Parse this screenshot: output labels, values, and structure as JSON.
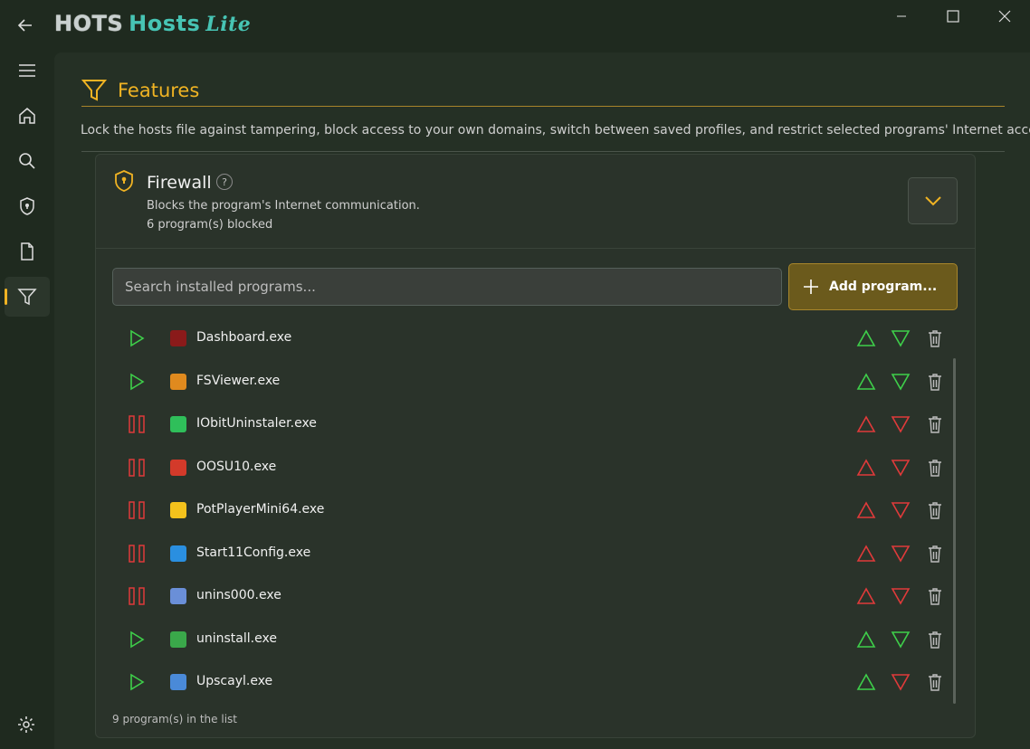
{
  "app": {
    "logo_hots": "HOTS",
    "logo_hosts": "Hosts",
    "logo_lite": "Lite"
  },
  "colors": {
    "accent": "#f0b323",
    "allow": "#3ecf4a",
    "block": "#e03a3a",
    "teal": "#47c4b4"
  },
  "sidebar": {
    "items": [
      {
        "name": "menu",
        "icon": "hamburger-icon"
      },
      {
        "name": "home",
        "icon": "home-icon"
      },
      {
        "name": "search",
        "icon": "search-icon"
      },
      {
        "name": "protection",
        "icon": "shield-icon"
      },
      {
        "name": "document",
        "icon": "document-icon"
      },
      {
        "name": "features",
        "icon": "filter-icon",
        "active": true
      }
    ],
    "settings_icon": "gear-icon"
  },
  "page": {
    "title": "Features",
    "description": "Lock the hosts file against tampering, block access to your own domains, switch between saved profiles, and restrict selected programs' Internet access."
  },
  "firewall": {
    "title": "Firewall",
    "help": "?",
    "subtitle": "Blocks the program's Internet communication.",
    "blocked_count": "6 program(s) blocked",
    "search_placeholder": "Search installed programs...",
    "add_label": "Add program...",
    "list_count": "9 program(s) in the list",
    "programs": [
      {
        "name": "Dashboard.exe",
        "state": "allowed",
        "icon_color": "#8a1a1a",
        "up": "green",
        "down": "green"
      },
      {
        "name": "FSViewer.exe",
        "state": "allowed",
        "icon_color": "#e08a1e",
        "up": "green",
        "down": "green"
      },
      {
        "name": "IObitUninstaler.exe",
        "state": "blocked",
        "icon_color": "#2fbf5a",
        "up": "red",
        "down": "red"
      },
      {
        "name": "OOSU10.exe",
        "state": "blocked",
        "icon_color": "#d33a2a",
        "up": "red",
        "down": "red"
      },
      {
        "name": "PotPlayerMini64.exe",
        "state": "blocked",
        "icon_color": "#f4c21c",
        "up": "red",
        "down": "red"
      },
      {
        "name": "Start11Config.exe",
        "state": "blocked",
        "icon_color": "#2a8fe0",
        "up": "red",
        "down": "red"
      },
      {
        "name": "unins000.exe",
        "state": "blocked",
        "icon_color": "#6a8fd8",
        "up": "red",
        "down": "red"
      },
      {
        "name": "uninstall.exe",
        "state": "allowed",
        "icon_color": "#3aa84a",
        "up": "green",
        "down": "green"
      },
      {
        "name": "Upscayl.exe",
        "state": "allowed",
        "icon_color": "#4a8ad8",
        "up": "green",
        "down": "red"
      }
    ]
  }
}
